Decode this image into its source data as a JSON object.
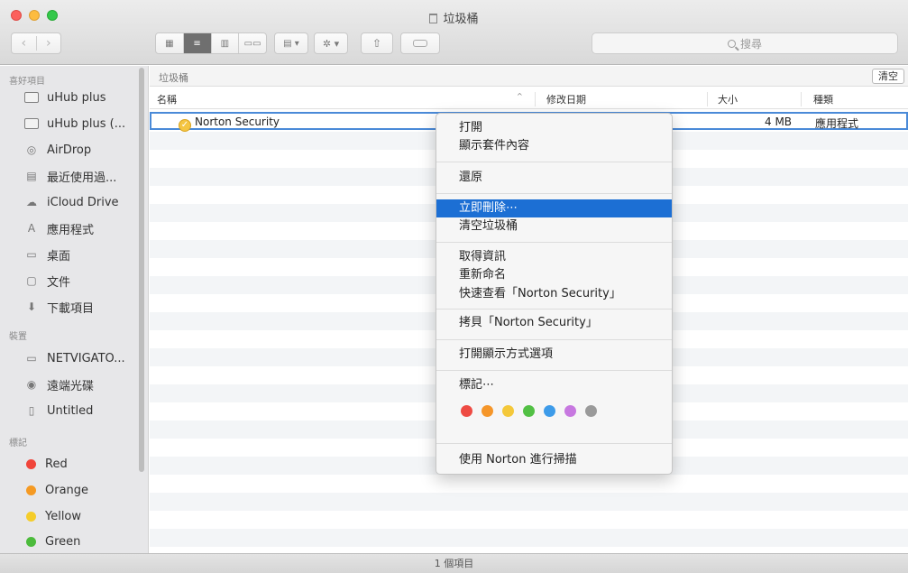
{
  "window": {
    "title": "垃圾桶"
  },
  "toolbar": {
    "back": "‹",
    "forward": "›",
    "view_icons": [
      "▦",
      "≡",
      "▥",
      "▭▭"
    ],
    "arrange_label": "▤ ▾",
    "action_label": "✲ ▾",
    "share_label": "⇧",
    "search_placeholder": "搜尋"
  },
  "sidebar": {
    "sections": {
      "favorites": "喜好項目",
      "devices": "裝置",
      "tags": "標記"
    },
    "favorites": [
      {
        "label": "uHub plus",
        "icon": "folder-icon"
      },
      {
        "label": "uHub plus (...",
        "icon": "folder-icon"
      },
      {
        "label": "AirDrop",
        "icon": "airdrop-icon"
      },
      {
        "label": "最近使用過...",
        "icon": "recents-icon"
      },
      {
        "label": "iCloud Drive",
        "icon": "cloud-icon"
      },
      {
        "label": "應用程式",
        "icon": "applications-icon"
      },
      {
        "label": "桌面",
        "icon": "desktop-icon"
      },
      {
        "label": "文件",
        "icon": "documents-icon"
      },
      {
        "label": "下載項目",
        "icon": "downloads-icon"
      }
    ],
    "devices": [
      {
        "label": "NETVIGATO...",
        "icon": "computer-icon"
      },
      {
        "label": "遠端光碟",
        "icon": "disc-icon"
      },
      {
        "label": "Untitled",
        "icon": "drive-icon"
      }
    ],
    "tags": [
      {
        "label": "Red",
        "color": "#f0453a"
      },
      {
        "label": "Orange",
        "color": "#f59a23"
      },
      {
        "label": "Yellow",
        "color": "#f5cd2a"
      },
      {
        "label": "Green",
        "color": "#4cbb3c"
      }
    ]
  },
  "main": {
    "path_label": "垃圾桶",
    "empty_button": "清空",
    "columns": {
      "name": "名稱",
      "sort_arrow": "^",
      "modified": "修改日期",
      "size": "大小",
      "kind": "種類"
    },
    "file": {
      "name": "Norton Security",
      "size": "4 MB",
      "kind": "應用程式"
    }
  },
  "context_menu": {
    "items": [
      "打開",
      "顯示套件內容",
      "還原",
      "立即刪除⋯",
      "清空垃圾桶",
      "取得資訊",
      "重新命名",
      "快速查看「Norton Security」",
      "拷貝「Norton Security」",
      "打開顯示方式選項",
      "標記⋯",
      "使用 Norton 進行掃描"
    ],
    "highlighted_index": 3,
    "tag_colors": [
      "#ee4b43",
      "#f5962a",
      "#f4c83a",
      "#52c044",
      "#3d9be9",
      "#c778e0",
      "#9a9a9a"
    ]
  },
  "status_bar": {
    "text": "1 個項目"
  }
}
